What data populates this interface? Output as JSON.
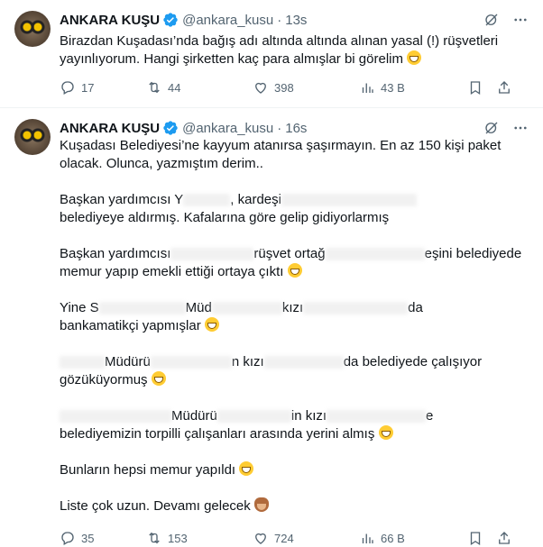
{
  "tweets": [
    {
      "name": "ANKARA KUŞU",
      "handle": "@ankara_kusu",
      "dot": "·",
      "time": "13s",
      "text": "Birazdan Kuşadası’nda bağış adı altında altında alınan yasal (!) rüşvetleri yayınlıyorum. Hangi şirketten kaç para almışlar bi görelim",
      "replies": "17",
      "retweets": "44",
      "likes": "398",
      "views": "43 B"
    },
    {
      "name": "ANKARA KUŞU",
      "handle": "@ankara_kusu",
      "dot": "·",
      "time": "16s",
      "paragraphs": {
        "p1": "Kuşadası Belediyesi’ne kayyum atanırsa şaşırmayın. En az 150 kişi paket olacak. Olunca, yazmıştım derim..",
        "p2a": "Başkan yardımcısı Y",
        "p2b": ", kardeşi",
        "p2c": "belediyeye aldırmış. Kafalarına göre gelip gidiyorlarmış",
        "p3a": "Başkan yardımcısı",
        "p3b": "rüşvet ortağ",
        "p3c": "eşini belediyede",
        "p3d": "memur yapıp emekli ettiği ortaya çıktı",
        "p4a": "Yine S",
        "p4b": "Müd",
        "p4c": "kızı",
        "p4d": "da",
        "p4e": "bankamatikçi yapmışlar",
        "p5a": "Müdürü",
        "p5b": "n kızı",
        "p5c": "da belediyede çalışıyor",
        "p5d": "gözüküyormuş",
        "p6a": "Müdürü",
        "p6b": "in kızı",
        "p6c": "e",
        "p6d": "belediyemizin torpilli çalışanları arasında yerini almış",
        "p7": "Bunların hepsi memur yapıldı",
        "p8": "Liste çok uzun. Devamı gelecek"
      },
      "replies": "35",
      "retweets": "153",
      "likes": "724",
      "views": "66 B"
    }
  ],
  "icons": {
    "verified": "verified-badge-icon",
    "grok": "grok-icon",
    "more": "more-options-icon",
    "reply": "reply-icon",
    "retweet": "retweet-icon",
    "like": "like-icon",
    "views": "views-icon",
    "bookmark": "bookmark-icon",
    "share": "share-icon"
  },
  "colors": {
    "accent": "#1d9bf0",
    "muted": "#536471",
    "text": "#0f1419"
  }
}
